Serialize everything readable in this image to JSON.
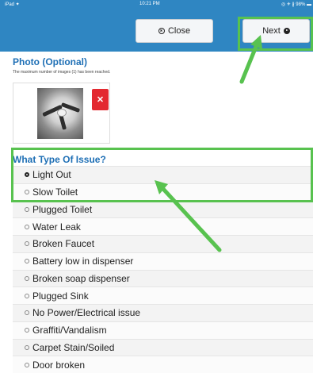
{
  "statusbar": {
    "left": "iPad ✦",
    "time": "10:21 PM",
    "right": "◎ ✈ ∦ 98% ▬"
  },
  "header": {
    "close_label": "Close",
    "next_label": "Next"
  },
  "photo": {
    "title": "Photo (Optional)",
    "note": "The maximum number of images (1) has been reached.",
    "delete_label": "✕"
  },
  "question": {
    "title": "What Type Of Issue?",
    "options": [
      "Light Out",
      "Slow Toilet",
      "Plugged Toilet",
      "Water Leak",
      "Broken Faucet",
      "Battery low in dispenser",
      "Broken soap dispenser",
      "Plugged Sink",
      "No Power/Electrical issue",
      "Graffiti/Vandalism",
      "Carpet Stain/Soiled",
      "Door broken"
    ],
    "selected_index": 0
  },
  "colors": {
    "header": "#2f86c2",
    "title": "#1e6fb5",
    "highlight": "#58c24f",
    "delete": "#e32930"
  },
  "icons": {
    "close": "close-circle-icon",
    "next": "arrow-right-circle-icon"
  }
}
